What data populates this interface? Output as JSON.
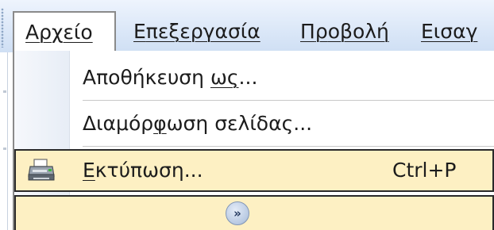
{
  "menubar": {
    "file": {
      "label": "Αρχείο",
      "mnemonic": "Α"
    },
    "edit": {
      "label": "Επεξεργασία",
      "mnemonic": "Ε"
    },
    "view": {
      "label": "Προβολή",
      "mnemonic": "ρ"
    },
    "insert": {
      "label": "Εισαγ"
    }
  },
  "file_menu": {
    "items": [
      {
        "label_pre": "Αποθήκευση ",
        "label_u": "ως",
        "label_post": "..."
      },
      {
        "label_pre": "Διαμόρ",
        "label_u": "φ",
        "label_post": "ωση σελίδας..."
      }
    ],
    "print": {
      "label_u": "Ε",
      "label_post": "κτύπωση...",
      "shortcut": "Ctrl+P",
      "icon": "printer-icon"
    },
    "expand": {
      "glyph": "»",
      "icon": "expand-chevrons-icon"
    }
  },
  "colors": {
    "highlight": "#fdf0c3",
    "menubar": "#dce8f8"
  }
}
